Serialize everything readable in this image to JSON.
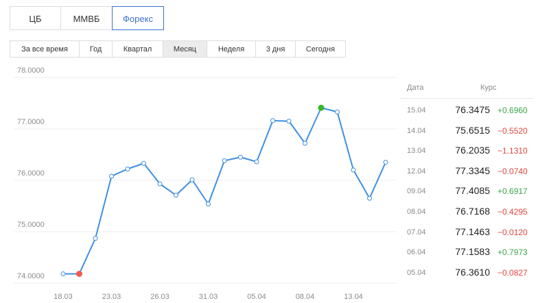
{
  "source_tabs": [
    {
      "label": "ЦБ",
      "active": false
    },
    {
      "label": "ММВБ",
      "active": false
    },
    {
      "label": "Форекс",
      "active": true
    }
  ],
  "period_tabs": [
    {
      "label": "За все время",
      "active": false
    },
    {
      "label": "Год",
      "active": false
    },
    {
      "label": "Квартал",
      "active": false
    },
    {
      "label": "Месяц",
      "active": true
    },
    {
      "label": "Неделя",
      "active": false
    },
    {
      "label": "3 дня",
      "active": false
    },
    {
      "label": "Сегодня",
      "active": false
    }
  ],
  "chart_data": {
    "type": "line",
    "title": "",
    "xlabel": "",
    "ylabel": "",
    "ylim": [
      74.0,
      78.0
    ],
    "y_ticks": [
      "74.0000",
      "75.0000",
      "76.0000",
      "77.0000",
      "78.0000"
    ],
    "x_ticks": [
      "18.03",
      "23.03",
      "26.03",
      "31.03",
      "05.04",
      "08.04",
      "13.04"
    ],
    "x_tick_index": [
      0,
      3,
      6,
      9,
      12,
      15,
      18
    ],
    "grid": true,
    "line_color": "#3d8fe0",
    "min_marker_color": "#f05a50",
    "max_marker_color": "#35b82a",
    "min_point_index": 1,
    "max_point_index": 16,
    "values": [
      74.18,
      74.18,
      74.87,
      76.08,
      76.22,
      76.33,
      75.93,
      75.71,
      76.01,
      75.54,
      76.38,
      76.45,
      76.36,
      77.16,
      77.15,
      76.72,
      77.41,
      77.33,
      76.2,
      75.65,
      76.35
    ]
  },
  "rates_table": {
    "date_header": "Дата",
    "rate_header": "Курс",
    "rows": [
      {
        "date": "15.04",
        "value": "76.3475",
        "change": "+0.6960",
        "dir": "up"
      },
      {
        "date": "14.04",
        "value": "75.6515",
        "change": "−0.5520",
        "dir": "down"
      },
      {
        "date": "13.04",
        "value": "76.2035",
        "change": "−1.1310",
        "dir": "down"
      },
      {
        "date": "12.04",
        "value": "77.3345",
        "change": "−0.0740",
        "dir": "down"
      },
      {
        "date": "09.04",
        "value": "77.4085",
        "change": "+0.6917",
        "dir": "up"
      },
      {
        "date": "08.04",
        "value": "76.7168",
        "change": "−0.4295",
        "dir": "down"
      },
      {
        "date": "07.04",
        "value": "77.1463",
        "change": "−0.0120",
        "dir": "down"
      },
      {
        "date": "06.04",
        "value": "77.1583",
        "change": "+0.7973",
        "dir": "up"
      },
      {
        "date": "05.04",
        "value": "76.3610",
        "change": "−0.0827",
        "dir": "down"
      }
    ]
  }
}
